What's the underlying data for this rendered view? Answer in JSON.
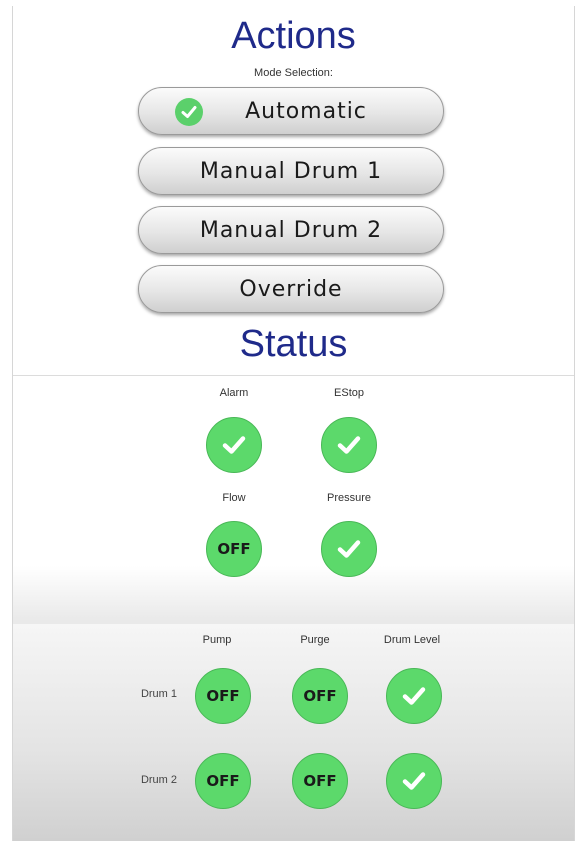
{
  "actions": {
    "title": "Actions",
    "mode_label": "Mode Selection:",
    "modes": [
      {
        "label": "Automatic",
        "selected": true
      },
      {
        "label": "Manual Drum 1",
        "selected": false
      },
      {
        "label": "Manual Drum 2",
        "selected": false
      },
      {
        "label": "Override",
        "selected": false
      }
    ]
  },
  "status": {
    "title": "Status",
    "indicators": [
      {
        "label": "Alarm",
        "state": "ok"
      },
      {
        "label": "EStop",
        "state": "ok"
      },
      {
        "label": "Flow",
        "state": "off",
        "text": "OFF"
      },
      {
        "label": "Pressure",
        "state": "ok"
      }
    ]
  },
  "drums": {
    "columns": [
      "Pump",
      "Purge",
      "Drum Level"
    ],
    "rows": [
      {
        "label": "Drum 1",
        "pump": "OFF",
        "purge": "OFF",
        "level_state": "ok"
      },
      {
        "label": "Drum 2",
        "pump": "OFF",
        "purge": "OFF",
        "level_state": "ok"
      }
    ]
  },
  "colors": {
    "heading": "#1f2a8a",
    "indicator_green": "#5cd96b",
    "check_white": "#ffffff"
  },
  "icons": {
    "ok": "check-icon"
  }
}
